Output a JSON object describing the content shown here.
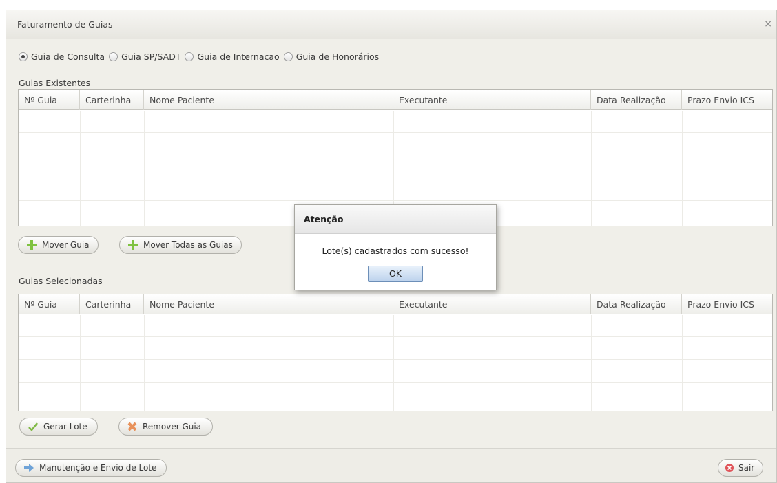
{
  "window": {
    "title": "Faturamento de Guias",
    "close_glyph": "×"
  },
  "guide_types": [
    {
      "label": "Guia de Consulta",
      "checked": true
    },
    {
      "label": "Guia SP/SADT",
      "checked": false
    },
    {
      "label": "Guia de Internacao",
      "checked": false
    },
    {
      "label": "Guia de Honorários",
      "checked": false
    }
  ],
  "existing": {
    "label": "Guias Existentes",
    "columns": [
      "Nº Guia",
      "Carterinha",
      "Nome Paciente",
      "Executante",
      "Data Realização",
      "Prazo Envio ICS"
    ]
  },
  "existing_buttons": {
    "move_label": "Mover Guia",
    "move_all_label": "Mover Todas as Guias"
  },
  "selected": {
    "label": "Guias Selecionadas",
    "columns": [
      "Nº Guia",
      "Carterinha",
      "Nome Paciente",
      "Executante",
      "Data Realização",
      "Prazo Envio ICS"
    ]
  },
  "selected_buttons": {
    "generate_label": "Gerar Lote",
    "remove_label": "Remover Guia"
  },
  "footer": {
    "maintenance_label": "Manutenção e Envio de Lote",
    "exit_label": "Sair"
  },
  "dialog": {
    "title": "Atenção",
    "message": "Lote(s) cadastrados com sucesso!",
    "ok_label": "OK"
  },
  "colors": {
    "add_icon": "#7fc241",
    "remove_icon": "#e8915a",
    "check_icon": "#7fb944",
    "arrow_icon": "#6fa3d8",
    "exit_icon": "#e0545a"
  }
}
